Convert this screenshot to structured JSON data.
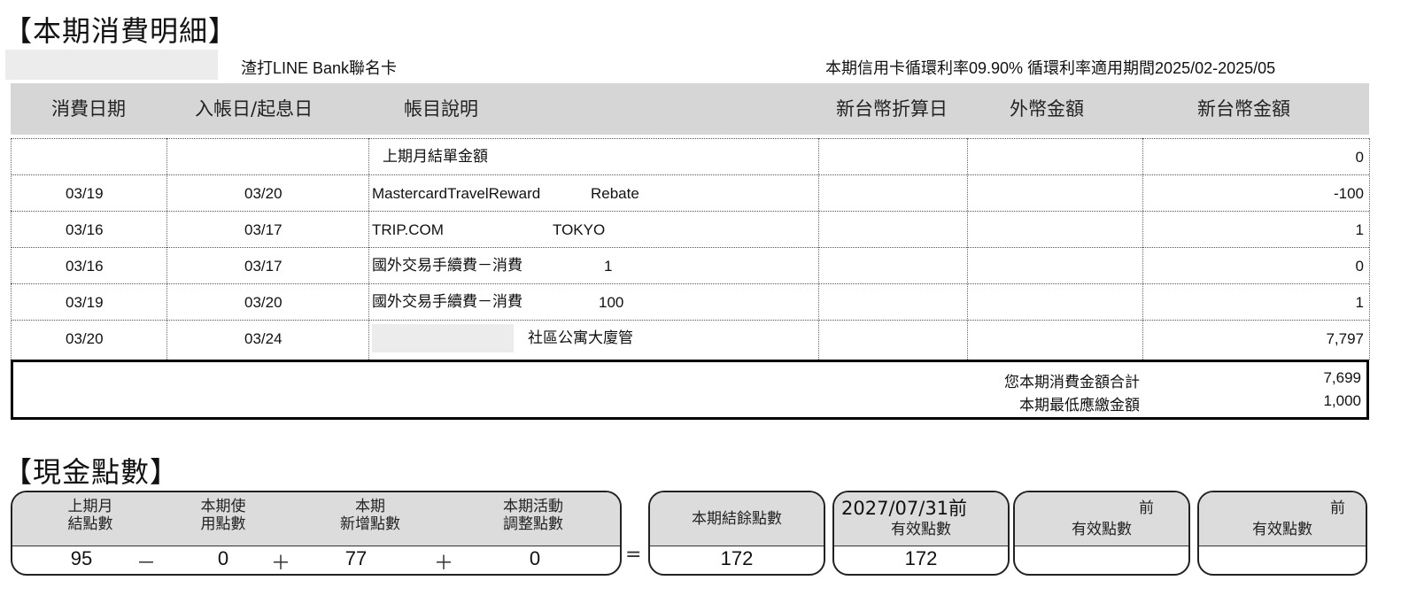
{
  "statement": {
    "section_title": "【本期消費明細】",
    "card_name": "渣打LINE Bank聯名卡",
    "rate_info": "本期信用卡循環利率09.90% 循環利率適用期間2025/02-2025/05",
    "columns": [
      "消費日期",
      "入帳日/起息日",
      "帳目說明",
      "新台幣折算日",
      "外幣金額",
      "新台幣金額"
    ],
    "rows": [
      {
        "date": "",
        "post_date": "",
        "desc_a": "上期月結單金額",
        "desc_b": "",
        "amount": "0"
      },
      {
        "date": "03/19",
        "post_date": "03/20",
        "desc_a": "MastercardTravelReward",
        "desc_b": "Rebate",
        "amount": "-100"
      },
      {
        "date": "03/16",
        "post_date": "03/17",
        "desc_a": "TRIP.COM",
        "desc_b": "TOKYO",
        "amount": "1"
      },
      {
        "date": "03/16",
        "post_date": "03/17",
        "desc_a": "國外交易手續費－消費",
        "desc_b": "1",
        "amount": "0"
      },
      {
        "date": "03/19",
        "post_date": "03/20",
        "desc_a": "國外交易手續費－消費",
        "desc_b": "100",
        "amount": "1"
      },
      {
        "date": "03/20",
        "post_date": "03/24",
        "desc_a": "",
        "desc_b": "社區公寓大廈管",
        "amount": "7,797"
      }
    ],
    "totals": [
      {
        "label": "您本期消費金額合計",
        "value": "7,699"
      },
      {
        "label": "本期最低應繳金額",
        "value": "1,000"
      }
    ]
  },
  "points": {
    "section_title": "【現金點數】",
    "prev_label": [
      "上期月",
      "結點數"
    ],
    "prev_value": "95",
    "op_minus": "－",
    "used_label": [
      "本期使",
      "用點數"
    ],
    "used_value": "0",
    "op_plus": "＋",
    "added_label": [
      "本期",
      "新增點數"
    ],
    "added_value": "77",
    "adjust_label": [
      "本期活動",
      "調整點數"
    ],
    "adjust_value": "0",
    "op_equals": "=",
    "balance_label": "本期結餘點數",
    "balance_value": "172",
    "expiry1_date": "2027/07/31前",
    "expiry1_label": "有效點數",
    "expiry1_value": "172",
    "expiry2_suffix": "前",
    "expiry2_label": "有效點數",
    "expiry3_suffix": "前",
    "expiry3_label": "有效點數"
  }
}
